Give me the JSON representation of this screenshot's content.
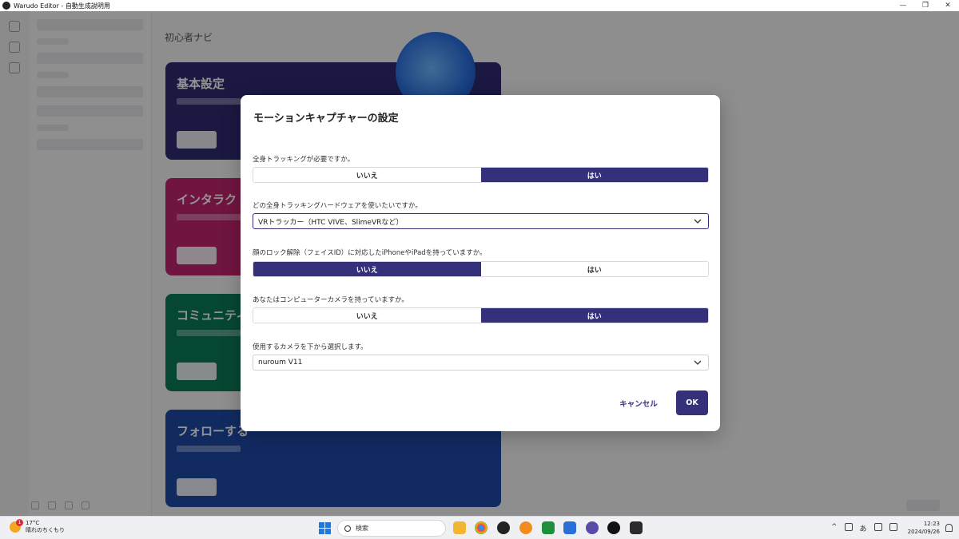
{
  "window": {
    "title": "Warudo Editor - 自動生成説明用",
    "minimize": "—",
    "maximize": "❐",
    "close": "✕"
  },
  "background": {
    "page_title": "初心者ナビ",
    "cards": [
      {
        "title": "基本設定",
        "color": "#2f2a73"
      },
      {
        "title": "インタラク",
        "color": "#c2256f"
      },
      {
        "title": "コミュニティ",
        "color": "#0c7a5a"
      },
      {
        "title": "フォローする",
        "color": "#1e4aa8"
      }
    ]
  },
  "dialog": {
    "title": "モーションキャプチャーの設定",
    "questions": {
      "full_body": {
        "label": "全身トラッキングが必要ですか。",
        "options": [
          "いいえ",
          "はい"
        ],
        "selected": "はい"
      },
      "hardware": {
        "label": "どの全身トラッキングハードウェアを使いたいですか。",
        "value": "VRトラッカー（HTC VIVE、SlimeVRなど）"
      },
      "face_id": {
        "label": "顔のロック解除（フェイスID）に対応したiPhoneやiPadを持っていますか。",
        "options": [
          "いいえ",
          "はい"
        ],
        "selected": "いいえ"
      },
      "camera_owned": {
        "label": "あなたはコンピューターカメラを持っていますか。",
        "options": [
          "いいえ",
          "はい"
        ],
        "selected": "はい"
      },
      "camera_select": {
        "label": "使用するカメラを下から選択します。",
        "value": "nuroum V11"
      }
    },
    "cancel_label": "キャンセル",
    "ok_label": "OK"
  },
  "taskbar": {
    "weather_temp": "17°C",
    "weather_desc": "晴れのちくもり",
    "weather_badge": "1",
    "search_placeholder": "検索",
    "ime": "あ",
    "time": "12:23",
    "date": "2024/09/26"
  },
  "colors": {
    "accent": "#35307a",
    "overlay": "rgba(0,0,0,0.42)"
  }
}
